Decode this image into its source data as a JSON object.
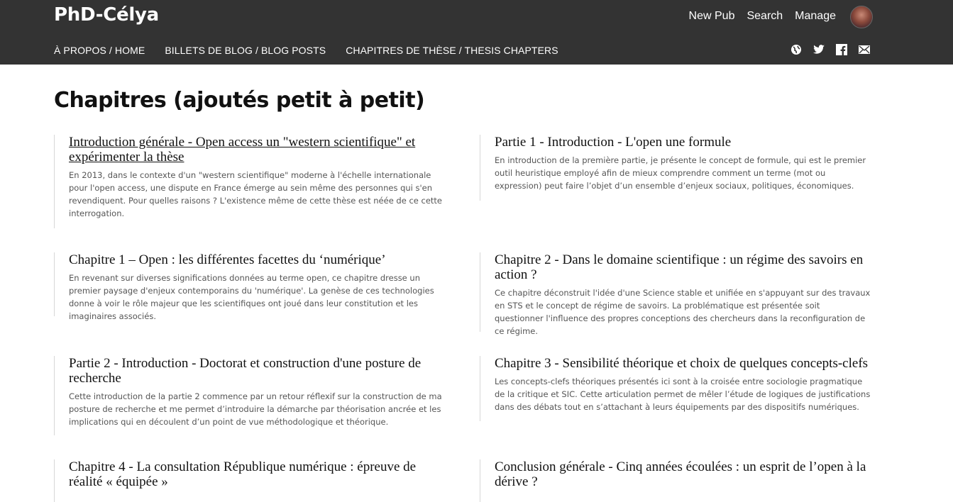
{
  "site": {
    "brand": "PhD-Célya",
    "top_links": [
      "New Pub",
      "Search",
      "Manage"
    ],
    "nav": [
      "À PROPOS / HOME",
      "BILLETS DE BLOG / BLOG POSTS",
      "CHAPITRES DE THÈSE / THESIS CHAPTERS"
    ],
    "social_icons": [
      "globe-icon",
      "twitter-icon",
      "facebook-icon",
      "mail-icon"
    ]
  },
  "page": {
    "title": "Chapitres (ajoutés petit à petit)"
  },
  "cards": [
    {
      "title": "Introduction générale - Open access un \"western scientifique\" et expérimenter la thèse",
      "excerpt": "En 2013, dans le contexte d'un \"western scientifique\" moderne à l'échelle internationale pour l'open access, une dispute en France émerge au sein même des personnes qui s'en revendiquent. Pour quelles raisons ? L'existence même de cette thèse est néée de ce cette interrogation."
    },
    {
      "title": "Partie 1 - Introduction - L'open une formule",
      "excerpt": "En introduction de la première partie, je présente le concept de formule, qui est le premier outil heuristique employé afin de mieux comprendre comment un terme (mot ou expression) peut faire l’objet d’un ensemble d’enjeux sociaux, politiques, économiques."
    },
    {
      "title": "Chapitre 1 – Open : les différentes facettes du ‘numérique’",
      "excerpt": "En revenant sur diverses significations données au terme open, ce chapitre dresse un premier paysage d'enjeux contemporains du 'numérique'. La genèse de ces technologies donne à voir le rôle majeur que les scientifiques ont joué dans leur constitution et les imaginaires associés."
    },
    {
      "title": "Chapitre 2 - Dans le domaine scientifique : un régime des savoirs en action ?",
      "excerpt": "Ce chapitre déconstruit l'idée d'une Science stable et unifiée en s'appuyant sur des travaux en STS et le concept de régime de savoirs. La problématique est présentée soit questionner l'influence des propres conceptions des chercheurs dans la reconfiguration de ce régime."
    },
    {
      "title": "Partie 2 - Introduction - Doctorat et construction d'une posture de recherche",
      "excerpt": "Cette introduction de la partie 2 commence par un retour réflexif sur la construction de ma posture de recherche et me permet d’introduire la démarche par théorisation ancrée et les implications qui en découlent d’un point de vue méthodologique et théorique."
    },
    {
      "title": "Chapitre 3 - Sensibilité théorique et choix de quelques concepts-clefs",
      "excerpt": "Les concepts-clefs théoriques présentés ici sont à la croisée entre sociologie pragmatique de la critique et SIC. Cette articulation permet de mêler l’étude de logiques de justifications dans des débats tout en s’attachant à leurs équipements par des dispositifs numériques."
    },
    {
      "title": "Chapitre 4 - La consultation République numérique : épreuve de réalité « équipée »",
      "excerpt": ""
    },
    {
      "title": "Conclusion générale - Cinq années écoulées : un esprit de l’open à la dérive ?",
      "excerpt": ""
    }
  ]
}
